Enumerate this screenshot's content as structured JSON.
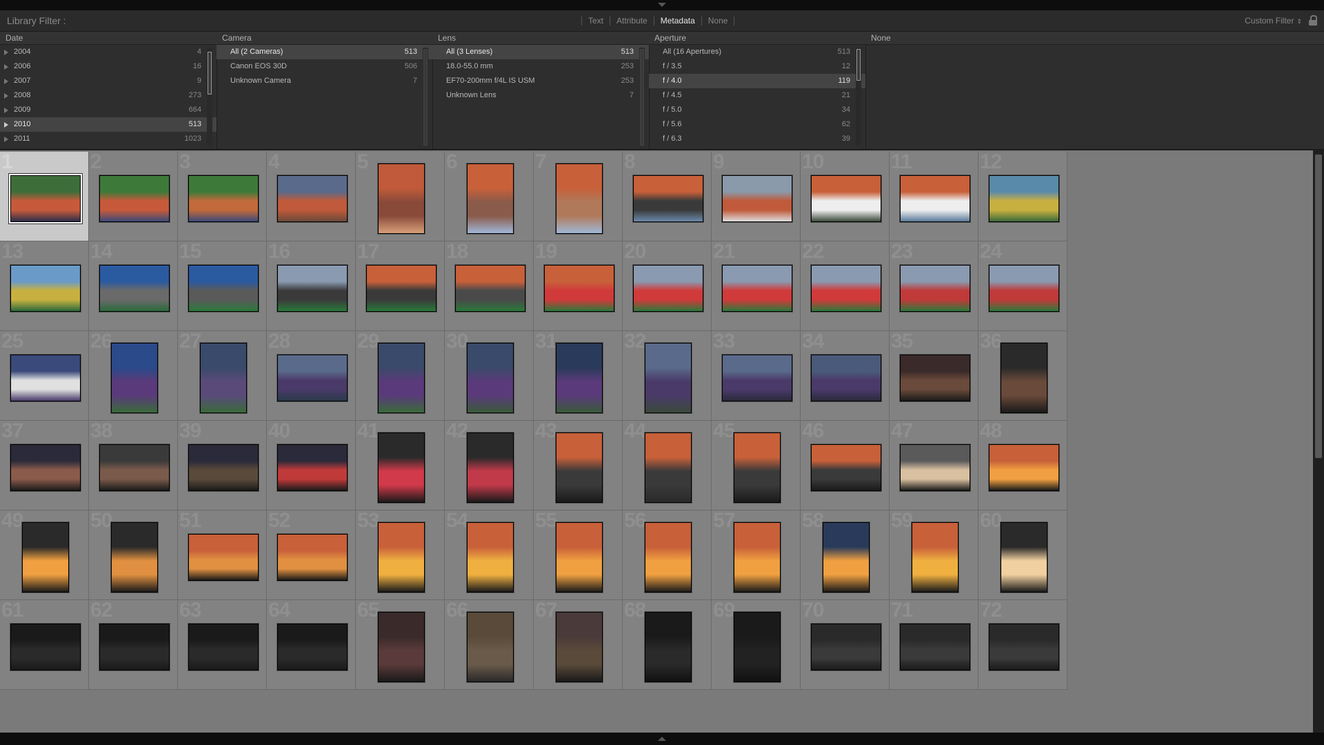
{
  "filter_bar": {
    "title": "Library Filter :",
    "modes": [
      "Text",
      "Attribute",
      "Metadata",
      "None"
    ],
    "active_mode": "Metadata",
    "preset": "Custom Filter"
  },
  "columns": [
    {
      "header": "Date",
      "rows": [
        {
          "label": "2004",
          "count": "4"
        },
        {
          "label": "2006",
          "count": "16"
        },
        {
          "label": "2007",
          "count": "9"
        },
        {
          "label": "2008",
          "count": "273"
        },
        {
          "label": "2009",
          "count": "664"
        },
        {
          "label": "2010",
          "count": "513",
          "selected": true
        },
        {
          "label": "2011",
          "count": "1023"
        }
      ]
    },
    {
      "header": "Camera",
      "rows": [
        {
          "label": "All (2 Cameras)",
          "count": "513",
          "selected": true
        },
        {
          "label": "Canon EOS 30D",
          "count": "506"
        },
        {
          "label": "Unknown Camera",
          "count": "7"
        }
      ]
    },
    {
      "header": "Lens",
      "rows": [
        {
          "label": "All (3 Lenses)",
          "count": "513",
          "selected": true
        },
        {
          "label": "18.0-55.0 mm",
          "count": "253"
        },
        {
          "label": "EF70-200mm f/4L IS USM",
          "count": "253"
        },
        {
          "label": "Unknown Lens",
          "count": "7"
        }
      ]
    },
    {
      "header": "Aperture",
      "rows": [
        {
          "label": "All (16 Apertures)",
          "count": "513"
        },
        {
          "label": "f / 3.5",
          "count": "12"
        },
        {
          "label": "f / 4.0",
          "count": "119",
          "selected": true
        },
        {
          "label": "f / 4.5",
          "count": "21"
        },
        {
          "label": "f / 5.0",
          "count": "34"
        },
        {
          "label": "f / 5.6",
          "count": "62"
        },
        {
          "label": "f / 6.3",
          "count": "39"
        }
      ]
    },
    {
      "header": "None",
      "rows": []
    }
  ],
  "grid": {
    "selected_index": 1,
    "cells": [
      {
        "n": "1",
        "o": "l",
        "c": [
          "#3d6e3a",
          "#c75a3a",
          "#2a2e4a"
        ]
      },
      {
        "n": "2",
        "o": "l",
        "c": [
          "#3d7a3a",
          "#c75a3a",
          "#3a4a7a"
        ]
      },
      {
        "n": "3",
        "o": "l",
        "c": [
          "#3d7a3a",
          "#c26a3a",
          "#3a4a7a"
        ]
      },
      {
        "n": "4",
        "o": "l",
        "c": [
          "#5a6a8a",
          "#c05a3a",
          "#6a4a3a"
        ]
      },
      {
        "n": "5",
        "o": "p",
        "c": [
          "#c05a3a",
          "#8a4a3a",
          "#d8a07a"
        ]
      },
      {
        "n": "6",
        "o": "p",
        "c": [
          "#c8603a",
          "#8a5a4a",
          "#a0b8d8"
        ]
      },
      {
        "n": "7",
        "o": "p",
        "c": [
          "#c8603a",
          "#b07a5a",
          "#a0b8d8"
        ]
      },
      {
        "n": "8",
        "o": "l",
        "c": [
          "#c8603a",
          "#3a3a3a",
          "#6a8aaa"
        ]
      },
      {
        "n": "9",
        "o": "l",
        "c": [
          "#8a9aaa",
          "#c05a3a",
          "#dddddd"
        ]
      },
      {
        "n": "10",
        "o": "l",
        "c": [
          "#c8603a",
          "#eeeeee",
          "#3a4a3a"
        ]
      },
      {
        "n": "11",
        "o": "l",
        "c": [
          "#c8603a",
          "#eeeeee",
          "#5a7a9a"
        ]
      },
      {
        "n": "12",
        "o": "l",
        "c": [
          "#5a8aaa",
          "#c8b040",
          "#3a6a3a"
        ]
      },
      {
        "n": "13",
        "o": "l",
        "c": [
          "#6a9ac8",
          "#c8b040",
          "#2a6a3a"
        ]
      },
      {
        "n": "14",
        "o": "l",
        "c": [
          "#2a5aa0",
          "#6a6a6a",
          "#2a6a3a"
        ]
      },
      {
        "n": "15",
        "o": "l",
        "c": [
          "#2a5aa0",
          "#5a5a5a",
          "#2a7a3a"
        ]
      },
      {
        "n": "16",
        "o": "l",
        "c": [
          "#8a9ab0",
          "#3a3a3a",
          "#2a7a3a"
        ]
      },
      {
        "n": "17",
        "o": "l",
        "c": [
          "#c8603a",
          "#3a3a3a",
          "#2a7a3a"
        ]
      },
      {
        "n": "18",
        "o": "l",
        "c": [
          "#c8603a",
          "#4a4a4a",
          "#2a7a3a"
        ]
      },
      {
        "n": "19",
        "o": "l",
        "c": [
          "#c8603a",
          "#d03a3a",
          "#2a7a3a"
        ]
      },
      {
        "n": "20",
        "o": "l",
        "c": [
          "#8a9ab0",
          "#d03a3a",
          "#2a7a3a"
        ]
      },
      {
        "n": "21",
        "o": "l",
        "c": [
          "#8a9ab0",
          "#d03a3a",
          "#2a7a3a"
        ]
      },
      {
        "n": "22",
        "o": "l",
        "c": [
          "#8a9ab0",
          "#d03a3a",
          "#2a7a3a"
        ]
      },
      {
        "n": "23",
        "o": "l",
        "c": [
          "#8a9ab0",
          "#c03a3a",
          "#2a7a3a"
        ]
      },
      {
        "n": "24",
        "o": "l",
        "c": [
          "#8a9ab0",
          "#c03a3a",
          "#2a7a3a"
        ]
      },
      {
        "n": "25",
        "o": "l",
        "c": [
          "#3a4a7a",
          "#e0e0e0",
          "#4a3a6a"
        ]
      },
      {
        "n": "26",
        "o": "p",
        "c": [
          "#2a4a8a",
          "#5a3a7a",
          "#3a6a3a"
        ]
      },
      {
        "n": "27",
        "o": "p",
        "c": [
          "#3a4a6a",
          "#5a4a7a",
          "#3a6a3a"
        ]
      },
      {
        "n": "28",
        "o": "l",
        "c": [
          "#5a6a8a",
          "#4a3a6a",
          "#2a3a4a"
        ]
      },
      {
        "n": "29",
        "o": "p",
        "c": [
          "#3a4a6a",
          "#5a3a7a",
          "#3a6a3a"
        ]
      },
      {
        "n": "30",
        "o": "p",
        "c": [
          "#3a4a6a",
          "#5a3a7a",
          "#3a5a3a"
        ]
      },
      {
        "n": "31",
        "o": "p",
        "c": [
          "#2a3a5a",
          "#5a3a7a",
          "#3a5a3a"
        ]
      },
      {
        "n": "32",
        "o": "p",
        "c": [
          "#5a6a8a",
          "#4a3a6a",
          "#3a4a3a"
        ]
      },
      {
        "n": "33",
        "o": "l",
        "c": [
          "#5a6a8a",
          "#4a3a6a",
          "#2a2a3a"
        ]
      },
      {
        "n": "34",
        "o": "l",
        "c": [
          "#4a5a7a",
          "#4a3a6a",
          "#2a2a3a"
        ]
      },
      {
        "n": "35",
        "o": "l",
        "c": [
          "#3a2a2a",
          "#6a4a3a",
          "#1a1a1a"
        ]
      },
      {
        "n": "36",
        "o": "p",
        "c": [
          "#2a2a2a",
          "#6a4a3a",
          "#1a1a1a"
        ]
      },
      {
        "n": "37",
        "o": "l",
        "c": [
          "#2a2a3a",
          "#8a5a4a",
          "#1a1a1a"
        ]
      },
      {
        "n": "38",
        "o": "l",
        "c": [
          "#3a3a3a",
          "#7a5a4a",
          "#1a1a1a"
        ]
      },
      {
        "n": "39",
        "o": "l",
        "c": [
          "#2a2a3a",
          "#5a4a3a",
          "#1a1a1a"
        ]
      },
      {
        "n": "40",
        "o": "l",
        "c": [
          "#2a2a3a",
          "#c03a3a",
          "#1a1a1a"
        ]
      },
      {
        "n": "41",
        "o": "p",
        "c": [
          "#2a2a2a",
          "#d03a4a",
          "#1a1a1a"
        ]
      },
      {
        "n": "42",
        "o": "p",
        "c": [
          "#2a2a2a",
          "#c03a4a",
          "#1a1a1a"
        ]
      },
      {
        "n": "43",
        "o": "p",
        "c": [
          "#c8603a",
          "#3a3a3a",
          "#1a1a1a"
        ]
      },
      {
        "n": "44",
        "o": "p",
        "c": [
          "#c8603a",
          "#3a3a3a",
          "#2a2a2a"
        ]
      },
      {
        "n": "45",
        "o": "p",
        "c": [
          "#c8603a",
          "#3a3a3a",
          "#1a1a1a"
        ]
      },
      {
        "n": "46",
        "o": "l",
        "c": [
          "#c8603a",
          "#3a3a3a",
          "#1a1a1a"
        ]
      },
      {
        "n": "47",
        "o": "l",
        "c": [
          "#5a5a5a",
          "#d8c0a0",
          "#1a1a1a"
        ]
      },
      {
        "n": "48",
        "o": "l",
        "c": [
          "#c8603a",
          "#f0a040",
          "#1a1a1a"
        ]
      },
      {
        "n": "49",
        "o": "p",
        "c": [
          "#2a2a2a",
          "#f0a040",
          "#1a1a1a"
        ]
      },
      {
        "n": "50",
        "o": "p",
        "c": [
          "#2a2a2a",
          "#e09040",
          "#1a1a1a"
        ]
      },
      {
        "n": "51",
        "o": "l",
        "c": [
          "#c8603a",
          "#e09040",
          "#1a1a1a"
        ]
      },
      {
        "n": "52",
        "o": "l",
        "c": [
          "#c8603a",
          "#e09040",
          "#1a1a1a"
        ]
      },
      {
        "n": "53",
        "o": "p",
        "c": [
          "#c8603a",
          "#f0b040",
          "#1a1a1a"
        ]
      },
      {
        "n": "54",
        "o": "p",
        "c": [
          "#c8603a",
          "#f0b040",
          "#1a1a1a"
        ]
      },
      {
        "n": "55",
        "o": "p",
        "c": [
          "#c8603a",
          "#f0a040",
          "#1a1a1a"
        ]
      },
      {
        "n": "56",
        "o": "p",
        "c": [
          "#c8603a",
          "#f0a040",
          "#1a1a1a"
        ]
      },
      {
        "n": "57",
        "o": "p",
        "c": [
          "#c8603a",
          "#f0a040",
          "#1a1a1a"
        ]
      },
      {
        "n": "58",
        "o": "p",
        "c": [
          "#2a3a5a",
          "#f0a040",
          "#1a1a1a"
        ]
      },
      {
        "n": "59",
        "o": "p",
        "c": [
          "#c8603a",
          "#f0b040",
          "#1a1a1a"
        ]
      },
      {
        "n": "60",
        "o": "p",
        "c": [
          "#2a2a2a",
          "#f0d0a0",
          "#1a1a1a"
        ]
      },
      {
        "n": "61",
        "o": "l",
        "c": [
          "#1a1a1a",
          "#2a2a2a",
          "#1a1a1a"
        ]
      },
      {
        "n": "62",
        "o": "l",
        "c": [
          "#1a1a1a",
          "#2a2a2a",
          "#1a1a1a"
        ]
      },
      {
        "n": "63",
        "o": "l",
        "c": [
          "#1a1a1a",
          "#2a2a2a",
          "#1a1a1a"
        ]
      },
      {
        "n": "64",
        "o": "l",
        "c": [
          "#1a1a1a",
          "#2a2a2a",
          "#1a1a1a"
        ]
      },
      {
        "n": "65",
        "o": "p",
        "c": [
          "#3a2a2a",
          "#5a3a3a",
          "#1a1a1a"
        ]
      },
      {
        "n": "66",
        "o": "p",
        "c": [
          "#5a4a3a",
          "#6a5a4a",
          "#2a2a2a"
        ]
      },
      {
        "n": "67",
        "o": "p",
        "c": [
          "#4a3a3a",
          "#5a4a3a",
          "#1a1a1a"
        ]
      },
      {
        "n": "68",
        "o": "p",
        "c": [
          "#1a1a1a",
          "#2a2a2a",
          "#111111"
        ]
      },
      {
        "n": "69",
        "o": "p",
        "c": [
          "#1a1a1a",
          "#222222",
          "#111111"
        ]
      },
      {
        "n": "70",
        "o": "l",
        "c": [
          "#2a2a2a",
          "#3a3a3a",
          "#1a1a1a"
        ]
      },
      {
        "n": "71",
        "o": "l",
        "c": [
          "#2a2a2a",
          "#3a3a3a",
          "#1a1a1a"
        ]
      },
      {
        "n": "72",
        "o": "l",
        "c": [
          "#2a2a2a",
          "#3a3a3a",
          "#1a1a1a"
        ]
      }
    ]
  }
}
